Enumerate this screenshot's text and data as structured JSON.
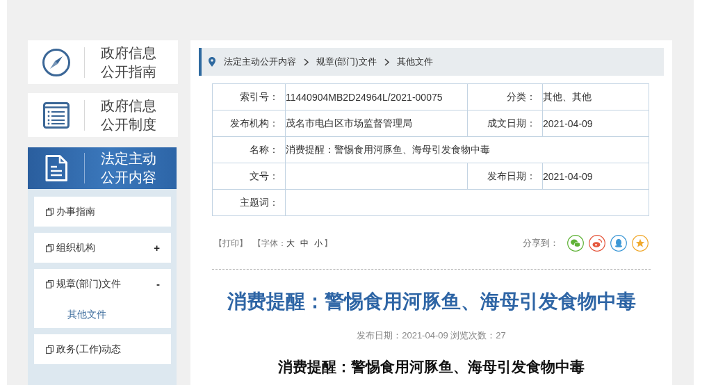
{
  "sidebar": {
    "cards": [
      {
        "kind": "compass",
        "lines": [
          "政府信息",
          "公开指南"
        ],
        "selected": false
      },
      {
        "kind": "list",
        "lines": [
          "政府信息",
          "公开制度"
        ],
        "selected": false
      },
      {
        "kind": "document",
        "lines": [
          "法定主动",
          "公开内容"
        ],
        "selected": true
      }
    ],
    "menu": [
      {
        "label": "办事指南"
      },
      {
        "label": "组织机构",
        "toggle": "+"
      },
      {
        "label": "规章(部门)文件",
        "toggle": "-",
        "children": [
          {
            "label": "其他文件",
            "selected": true
          }
        ]
      },
      {
        "label": "政务(工作)动态"
      }
    ]
  },
  "breadcrumb": [
    "法定主动公开内容",
    "规章(部门)文件",
    "其他文件"
  ],
  "info_table": {
    "rows": [
      [
        {
          "label": "索引号：",
          "value": "11440904MB2D24964L/2021-00075"
        },
        {
          "label": "分类：",
          "value": "其他、其他"
        }
      ],
      [
        {
          "label": "发布机构：",
          "value": "茂名市电白区市场监督管理局"
        },
        {
          "label": "成文日期：",
          "value": "2021-04-09"
        }
      ],
      [
        {
          "label": "名称：",
          "value": "消费提醒：警惕食用河豚鱼、海母引发食物中毒"
        }
      ],
      [
        {
          "label": "文号："
        },
        {
          "label": "发布日期：",
          "value": "2021-04-09"
        }
      ],
      [
        {
          "label": "主题词："
        }
      ]
    ]
  },
  "tools": {
    "print": "【打印】",
    "font_label": "【字体：",
    "font_sizes": [
      "大",
      "中",
      "小"
    ],
    "font_end": "】"
  },
  "share": {
    "label": "分享到：",
    "targets": [
      {
        "kind": "wechat",
        "color": "#5fb236"
      },
      {
        "kind": "weibo",
        "color": "#e5583e"
      },
      {
        "kind": "qq",
        "color": "#3d98d6"
      },
      {
        "kind": "favorite",
        "color": "#f0a92e"
      }
    ]
  },
  "article": {
    "title": "消费提醒：警惕食用河豚鱼、海母引发食物中毒",
    "meta": "发布日期：2021-04-09 浏览次数：27",
    "subtitle": "消费提醒：警惕食用河豚鱼、海母引发食物中毒"
  }
}
